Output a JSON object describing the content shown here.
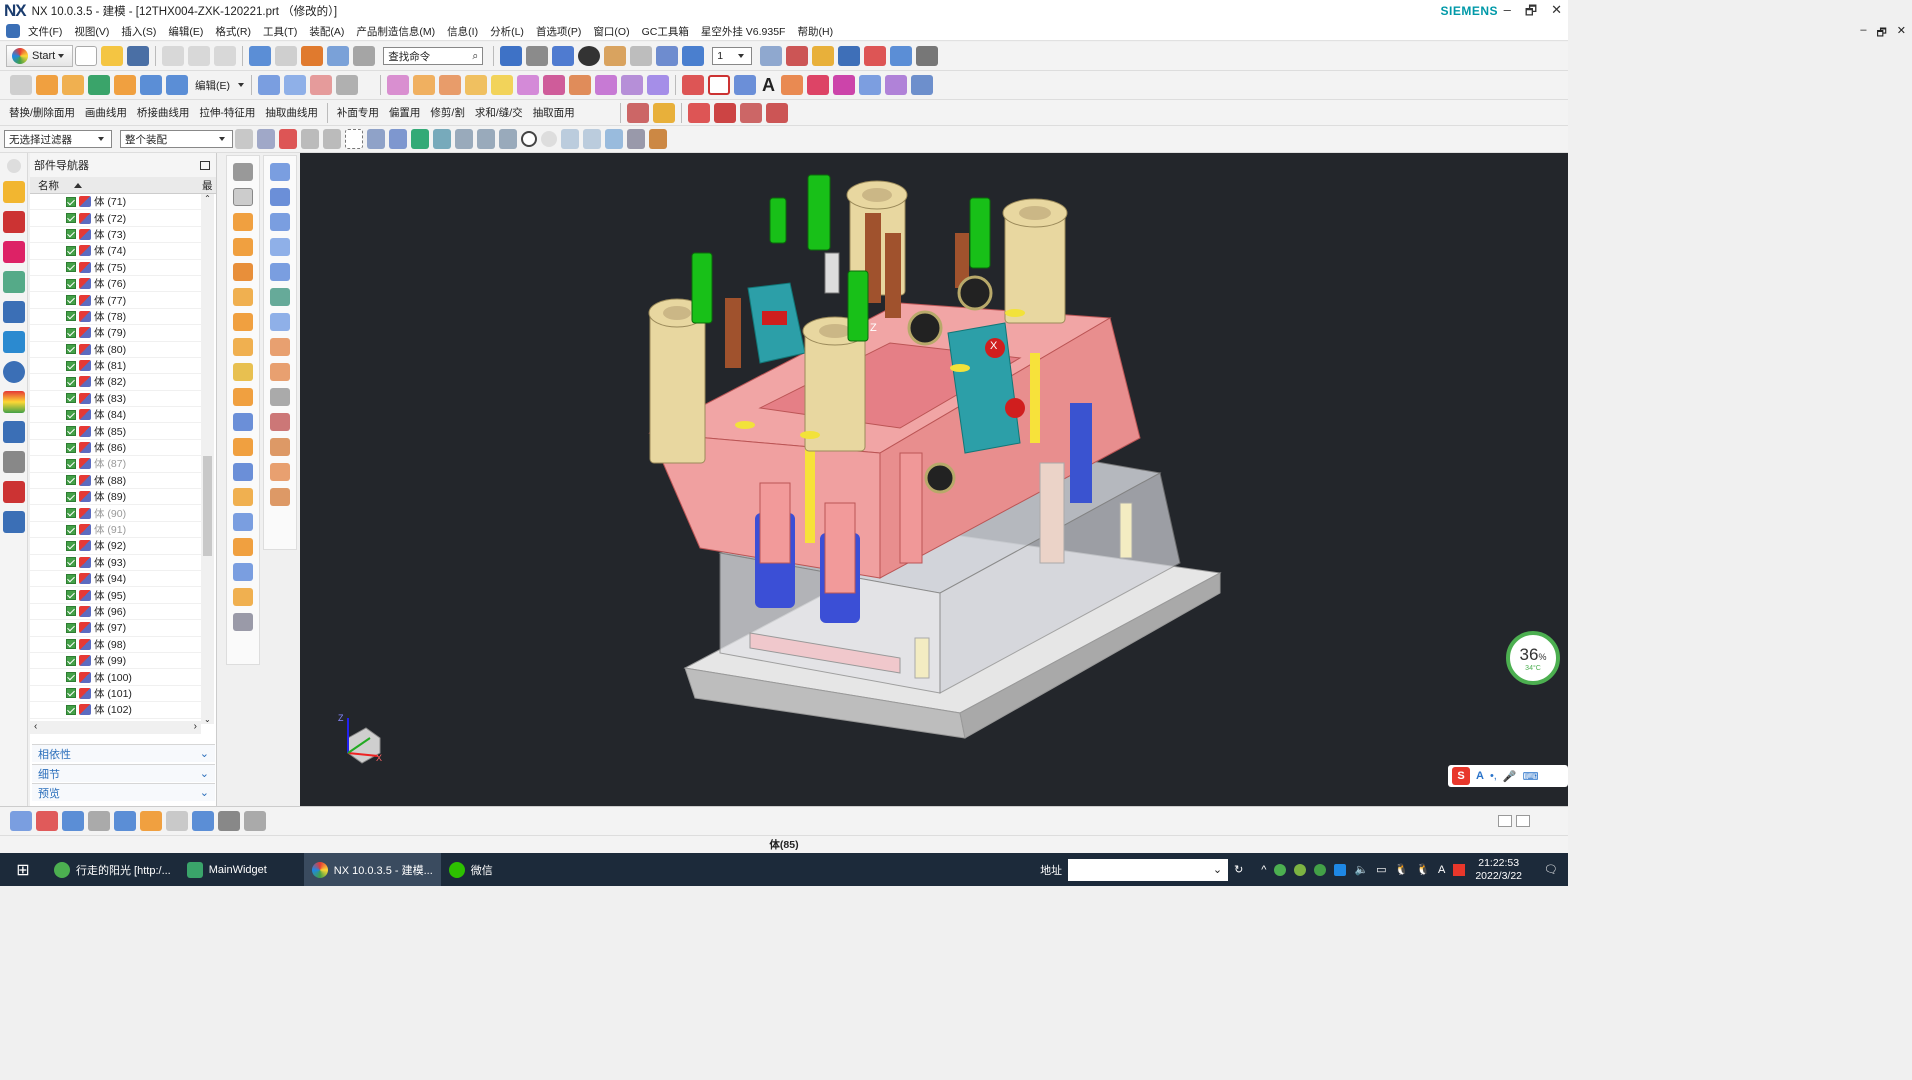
{
  "window": {
    "logo": "NX",
    "title": "NX 10.0.3.5 - 建模 - [12THX004-ZXK-120221.prt （修改的）]",
    "brand": "SIEMENS",
    "controls": [
      "–",
      "🗗",
      "✕"
    ]
  },
  "menu": {
    "items": [
      "文件(F)",
      "视图(V)",
      "插入(S)",
      "编辑(E)",
      "格式(R)",
      "工具(T)",
      "装配(A)",
      "产品制造信息(M)",
      "信息(I)",
      "分析(L)",
      "首选项(P)",
      "窗口(O)",
      "GC工具箱",
      "星空外挂 V6.935F",
      "帮助(H)"
    ],
    "mdi_controls": [
      "–",
      "🗗",
      "✕"
    ]
  },
  "toolbar": {
    "start_label": "Start",
    "search_placeholder": "查找命令",
    "layer_value": "1",
    "edit_label": "编辑(E)",
    "row3": [
      "替换/删除面用",
      "画曲线用",
      "桥接曲线用",
      "拉伸-特征用",
      "抽取曲线用",
      "补面专用",
      "偏置用",
      "修剪/割",
      "求和/缝/交",
      "抽取面用"
    ],
    "filter_value": "无选择过滤器",
    "assembly_value": "整个装配"
  },
  "navigator": {
    "title": "部件导航器",
    "col_name": "名称",
    "col_last": "最",
    "rows": [
      {
        "label": "体 (71)",
        "checked": true,
        "dim": false
      },
      {
        "label": "体 (72)",
        "checked": true,
        "dim": false
      },
      {
        "label": "体 (73)",
        "checked": true,
        "dim": false
      },
      {
        "label": "体 (74)",
        "checked": true,
        "dim": false
      },
      {
        "label": "体 (75)",
        "checked": true,
        "dim": false
      },
      {
        "label": "体 (76)",
        "checked": true,
        "dim": false
      },
      {
        "label": "体 (77)",
        "checked": true,
        "dim": false
      },
      {
        "label": "体 (78)",
        "checked": true,
        "dim": false
      },
      {
        "label": "体 (79)",
        "checked": true,
        "dim": false
      },
      {
        "label": "体 (80)",
        "checked": true,
        "dim": false
      },
      {
        "label": "体 (81)",
        "checked": true,
        "dim": false
      },
      {
        "label": "体 (82)",
        "checked": true,
        "dim": false
      },
      {
        "label": "体 (83)",
        "checked": true,
        "dim": false
      },
      {
        "label": "体 (84)",
        "checked": true,
        "dim": false
      },
      {
        "label": "体 (85)",
        "checked": true,
        "dim": false
      },
      {
        "label": "体 (86)",
        "checked": true,
        "dim": false
      },
      {
        "label": "体 (87)",
        "checked": true,
        "dim": true
      },
      {
        "label": "体 (88)",
        "checked": true,
        "dim": false
      },
      {
        "label": "体 (89)",
        "checked": true,
        "dim": false
      },
      {
        "label": "体 (90)",
        "checked": true,
        "dim": true
      },
      {
        "label": "体 (91)",
        "checked": true,
        "dim": true
      },
      {
        "label": "体 (92)",
        "checked": true,
        "dim": false
      },
      {
        "label": "体 (93)",
        "checked": true,
        "dim": false
      },
      {
        "label": "体 (94)",
        "checked": true,
        "dim": false
      },
      {
        "label": "体 (95)",
        "checked": true,
        "dim": false
      },
      {
        "label": "体 (96)",
        "checked": true,
        "dim": false
      },
      {
        "label": "体 (97)",
        "checked": true,
        "dim": false
      },
      {
        "label": "体 (98)",
        "checked": true,
        "dim": false
      },
      {
        "label": "体 (99)",
        "checked": true,
        "dim": false
      },
      {
        "label": "体 (100)",
        "checked": true,
        "dim": false
      },
      {
        "label": "体 (101)",
        "checked": true,
        "dim": false
      },
      {
        "label": "体 (102)",
        "checked": true,
        "dim": false
      }
    ],
    "sections": [
      "相依性",
      "细节",
      "预览"
    ]
  },
  "viewport": {
    "gauge_percent": "36",
    "gauge_unit": "%",
    "gauge_temp": "34°C",
    "axis_labels": {
      "z": "Z",
      "x": "X",
      "triad_z": "Z",
      "triad_x": "X"
    },
    "ime_label": "S",
    "ime_a": "A"
  },
  "status": {
    "text": "体(85)"
  },
  "taskbar": {
    "tasks": [
      "行走的阳光 [http:/...",
      "MainWidget",
      "NX 10.0.3.5 - 建模...",
      "微信"
    ],
    "address_label": "地址",
    "time": "21:22:53",
    "date": "2022/3/22"
  }
}
